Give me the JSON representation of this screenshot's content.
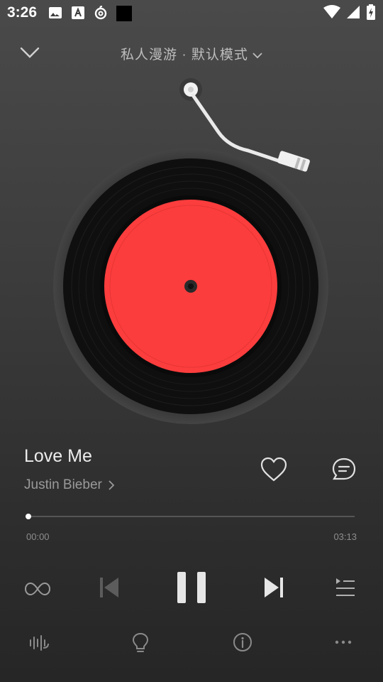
{
  "status_bar": {
    "time": "3:26",
    "icons": [
      "image-icon",
      "text-a-icon",
      "netease-icon",
      "black-square-icon"
    ],
    "right_icons": [
      "wifi-icon",
      "signal-icon",
      "battery-charging-icon"
    ]
  },
  "header": {
    "title": "私人漫游 · 默认模式",
    "collapse_icon": "chevron-down-icon"
  },
  "song": {
    "title": "Love Me",
    "artist": "Justin Bieber"
  },
  "progress": {
    "current": "00:00",
    "total": "03:13",
    "fraction": 0.0
  },
  "controls": [
    "infinite-loop-icon",
    "previous-icon",
    "pause-icon",
    "next-icon",
    "playlist-icon"
  ],
  "bottom_actions": [
    "audio-effect-icon",
    "lightbulb-icon",
    "info-icon",
    "more-icon"
  ],
  "colors": {
    "label_red": "#fc3d3d",
    "vinyl": "#0f0f0f"
  }
}
